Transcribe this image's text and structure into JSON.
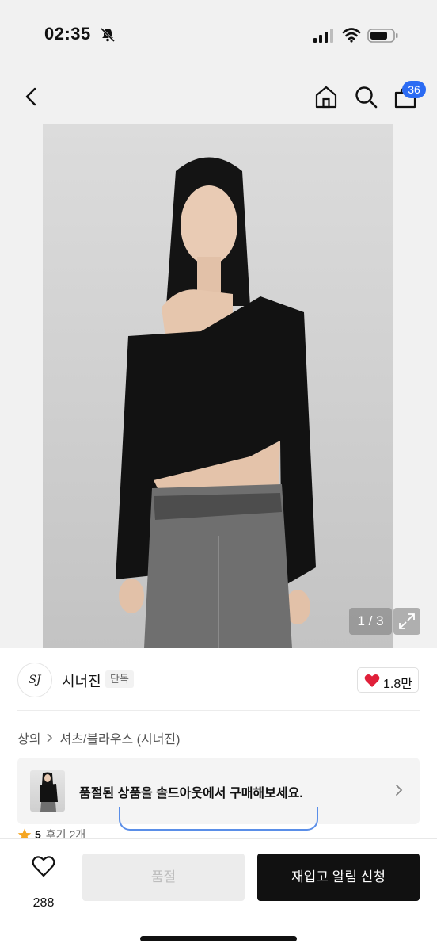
{
  "status_bar": {
    "time": "02:35",
    "icons": [
      "bell-slash-icon",
      "signal-icon",
      "wifi-icon",
      "battery-icon"
    ]
  },
  "nav": {
    "back_icon": "chevron-left-icon",
    "home_icon": "home-icon",
    "search_icon": "search-icon",
    "bag_icon": "shopping-bag-icon",
    "bag_count": "36"
  },
  "gallery": {
    "counter": "1 / 3",
    "expand_icon": "expand-icon"
  },
  "brand": {
    "logo_text": "SJ",
    "name": "시너진",
    "tag": "단독",
    "like_count": "1.8만"
  },
  "breadcrumb": {
    "category": "상의",
    "subcategory": "셔츠/블라우스 (시너진)"
  },
  "soldout_banner": {
    "text": "품절된 상품을 솔드아웃에서 구매해보세요."
  },
  "rating": {
    "score": "5",
    "reviews": "후기 2개"
  },
  "bottom_bar": {
    "wish_count": "288",
    "soldout_label": "품절",
    "restock_label": "재입고 알림 신청"
  },
  "colors": {
    "accent_badge": "#2b6bf3",
    "heart": "#e0203a",
    "star": "#f5a623",
    "primary_button": "#111111"
  }
}
